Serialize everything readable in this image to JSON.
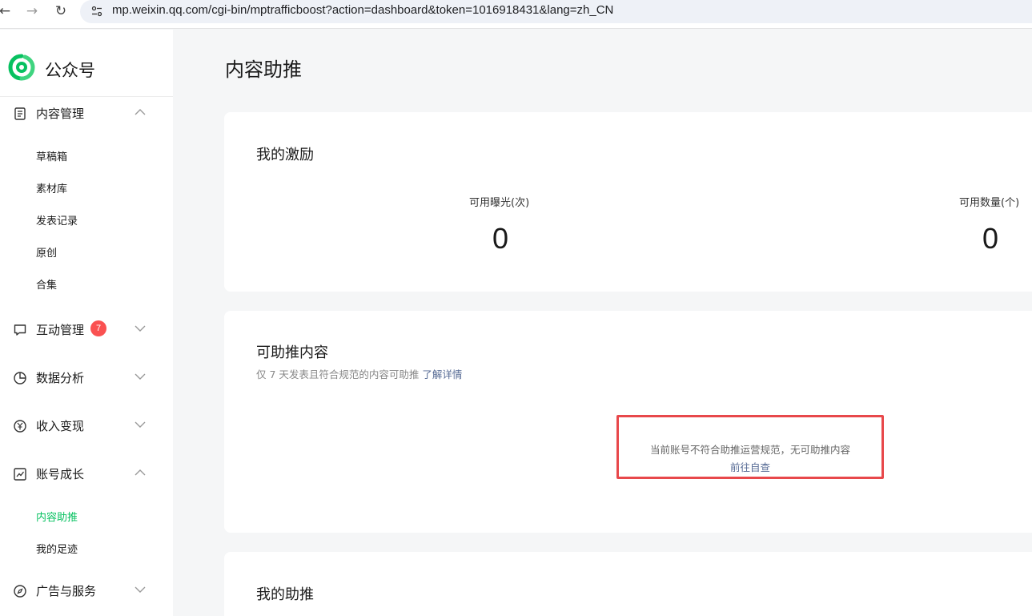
{
  "browser": {
    "back_icon": "arrow-left-icon",
    "forward_icon": "arrow-right-icon",
    "reload_icon": "reload-icon",
    "url": "mp.weixin.qq.com/cgi-bin/mptrafficboost?action=dashboard&token=1016918431&lang=zh_CN"
  },
  "brand": {
    "name": "公众号",
    "accent": "#07c160"
  },
  "sidebar": {
    "content_mgmt": {
      "label": "内容管理",
      "items": [
        "草稿箱",
        "素材库",
        "发表记录",
        "原创",
        "合集"
      ]
    },
    "interaction": {
      "label": "互动管理",
      "badge": "7"
    },
    "analytics": {
      "label": "数据分析"
    },
    "revenue": {
      "label": "收入变现"
    },
    "growth": {
      "label": "账号成长",
      "items": [
        "内容助推",
        "我的足迹"
      ],
      "active": "内容助推"
    },
    "ads": {
      "label": "广告与服务"
    }
  },
  "main": {
    "title": "内容助推",
    "incentive": {
      "title": "我的激励",
      "exposure_label": "可用曝光(次)",
      "exposure_value": "0",
      "count_label": "可用数量(个)",
      "count_value": "0"
    },
    "boostable": {
      "title": "可助推内容",
      "subtitle": "仅 7 天发表且符合规范的内容可助推",
      "learn_more": "了解详情",
      "empty_text": "当前账号不符合助推运营规范，无可助推内容",
      "self_check": "前往自查"
    },
    "my_boost": {
      "title": "我的助推"
    }
  }
}
